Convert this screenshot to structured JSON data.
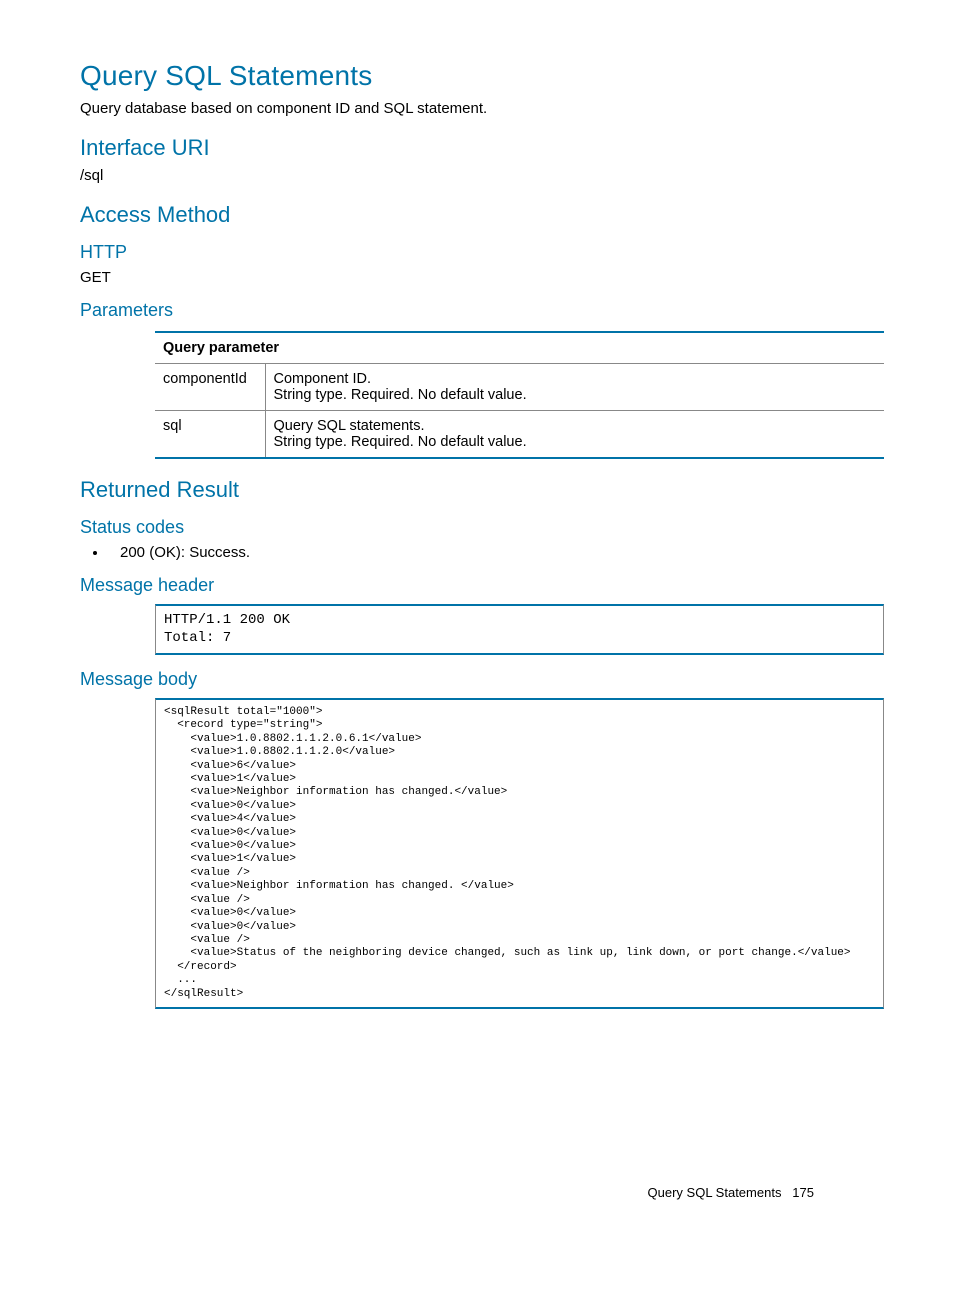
{
  "title": "Query SQL Statements",
  "intro": "Query database based on component ID and SQL statement.",
  "sections": {
    "interface_uri": {
      "heading": "Interface URI",
      "value": "/sql"
    },
    "access_method": {
      "heading": "Access Method",
      "http": {
        "heading": "HTTP",
        "value": "GET"
      },
      "parameters": {
        "heading": "Parameters",
        "table_header": "Query parameter",
        "rows": [
          {
            "name": "componentId",
            "desc1": "Component ID.",
            "desc2": "String type. Required. No default value."
          },
          {
            "name": "sql",
            "desc1": "Query SQL statements.",
            "desc2": "String type. Required. No default value."
          }
        ]
      }
    },
    "returned_result": {
      "heading": "Returned Result",
      "status_codes": {
        "heading": "Status codes",
        "items": [
          "200 (OK): Success."
        ]
      },
      "message_header": {
        "heading": "Message header",
        "code": "HTTP/1.1 200 OK\nTotal: 7"
      },
      "message_body": {
        "heading": "Message body",
        "code": "<sqlResult total=\"1000\">\n  <record type=\"string\">\n    <value>1.0.8802.1.1.2.0.6.1</value>\n    <value>1.0.8802.1.1.2.0</value>\n    <value>6</value>\n    <value>1</value>\n    <value>Neighbor information has changed.</value>\n    <value>0</value>\n    <value>4</value>\n    <value>0</value>\n    <value>0</value>\n    <value>1</value>\n    <value />\n    <value>Neighbor information has changed. </value>\n    <value />\n    <value>0</value>\n    <value>0</value>\n    <value />\n    <value>Status of the neighboring device changed, such as link up, link down, or port change.</value>\n  </record>\n  ...\n</sqlResult>"
      }
    }
  },
  "footer": {
    "label": "Query SQL Statements",
    "page": "175"
  }
}
